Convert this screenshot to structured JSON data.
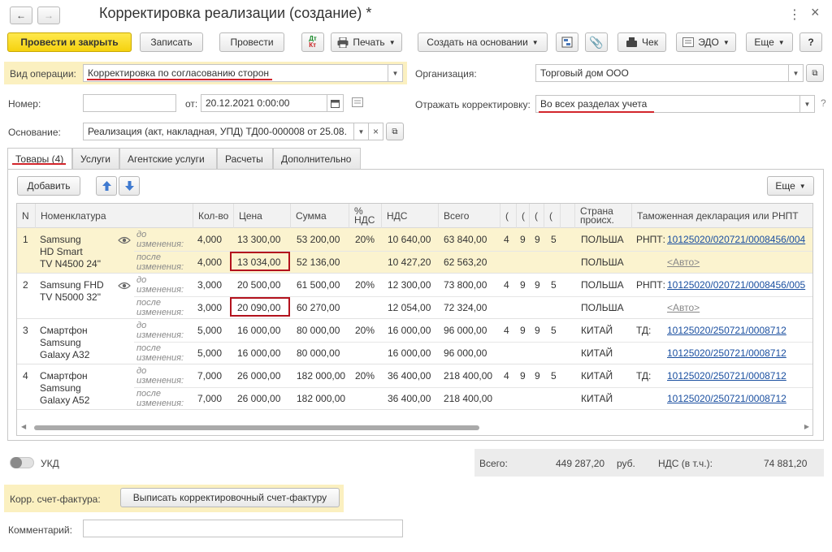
{
  "window": {
    "title": "Корректировка реализации (создание) *",
    "back_glyph": "←",
    "forward_glyph": "→",
    "star_glyph": "☆",
    "more_glyph": "⋮",
    "close_glyph": "×"
  },
  "toolbar": {
    "post_close": "Провести и закрыть",
    "save": "Записать",
    "post": "Провести",
    "dtkt_top": "Дт",
    "dtkt_bottom": "Кт",
    "print": "Печать",
    "create_based": "Создать на основании",
    "check": "Чек",
    "edo": "ЭДО",
    "more": "Еще",
    "help": "?"
  },
  "form": {
    "operation_label": "Вид операции:",
    "operation_value": "Корректировка по согласованию сторон",
    "number_label": "Номер:",
    "number_value": "",
    "date_label": "от:",
    "date_value": "20.12.2021  0:00:00",
    "basis_label": "Основание:",
    "basis_value": "Реализация (акт, накладная, УПД) ТД00-000008 от 25.08.",
    "org_label": "Организация:",
    "org_value": "Торговый дом ООО",
    "reflect_label": "Отражать корректировку:",
    "reflect_value": "Во всех разделах учета"
  },
  "tabs": [
    "Товары (4)",
    "Услуги",
    "Агентские услуги",
    "Расчеты",
    "Дополнительно"
  ],
  "table_toolbar": {
    "add": "Добавить",
    "more": "Еще"
  },
  "columns": {
    "n": "N",
    "item": "Номенклатура",
    "qty": "Кол-во",
    "price": "Цена",
    "sum": "Сумма",
    "vat_rate_1": "%",
    "vat_rate_2": "НДС",
    "vat": "НДС",
    "total": "Всего",
    "c1": "(",
    "c2": "(",
    "c3": "(",
    "c4": "(",
    "country_1": "Страна",
    "country_2": "происх.",
    "customs": "Таможенная декларация или РНПТ"
  },
  "before_note": [
    "до",
    "изменения:"
  ],
  "after_note": [
    "после",
    "изменения:"
  ],
  "rows": [
    {
      "n": "1",
      "item": [
        "Samsung",
        "HD Smart",
        "TV N4500 24\""
      ],
      "eye": true,
      "before": {
        "qty": "4,000",
        "price": "13 300,00",
        "sum": "53 200,00",
        "rate": "20%",
        "vat": "10 640,00",
        "total": "63 840,00",
        "c1": "4",
        "c2": "9",
        "c3": "9",
        "c4": "5",
        "country": "ПОЛЬША",
        "decl_prefix": "РНПТ:",
        "decl": "10125020/020721/0008456/004"
      },
      "after": {
        "qty": "4,000",
        "price": "13 034,00",
        "sum": "52 136,00",
        "vat": "10 427,20",
        "total": "62 563,20",
        "country": "ПОЛЬША",
        "decl": "<Авто>"
      }
    },
    {
      "n": "2",
      "item": [
        "Samsung FHD",
        "TV N5000 32\""
      ],
      "eye": true,
      "before": {
        "qty": "3,000",
        "price": "20 500,00",
        "sum": "61 500,00",
        "rate": "20%",
        "vat": "12 300,00",
        "total": "73 800,00",
        "c1": "4",
        "c2": "9",
        "c3": "9",
        "c4": "5",
        "country": "ПОЛЬША",
        "decl_prefix": "РНПТ:",
        "decl": "10125020/020721/0008456/005"
      },
      "after": {
        "qty": "3,000",
        "price": "20 090,00",
        "sum": "60 270,00",
        "vat": "12 054,00",
        "total": "72 324,00",
        "country": "ПОЛЬША",
        "decl": "<Авто>"
      }
    },
    {
      "n": "3",
      "item": [
        "Смартфон",
        "Samsung",
        "Galaxy A32"
      ],
      "eye": false,
      "before": {
        "qty": "5,000",
        "price": "16 000,00",
        "sum": "80 000,00",
        "rate": "20%",
        "vat": "16 000,00",
        "total": "96 000,00",
        "c1": "4",
        "c2": "9",
        "c3": "9",
        "c4": "5",
        "country": "КИТАЙ",
        "decl_prefix": "ТД:",
        "decl": "10125020/250721/0008712"
      },
      "after": {
        "qty": "5,000",
        "price": "16 000,00",
        "sum": "80 000,00",
        "vat": "16 000,00",
        "total": "96 000,00",
        "country": "КИТАЙ",
        "decl": "10125020/250721/0008712"
      }
    },
    {
      "n": "4",
      "item": [
        "Смартфон",
        "Samsung",
        "Galaxy A52"
      ],
      "eye": false,
      "before": {
        "qty": "7,000",
        "price": "26 000,00",
        "sum": "182 000,00",
        "rate": "20%",
        "vat": "36 400,00",
        "total": "218 400,00",
        "c1": "4",
        "c2": "9",
        "c3": "9",
        "c4": "5",
        "country": "КИТАЙ",
        "decl_prefix": "ТД:",
        "decl": "10125020/250721/0008712"
      },
      "after": {
        "qty": "7,000",
        "price": "26 000,00",
        "sum": "182 000,00",
        "vat": "36 400,00",
        "total": "218 400,00",
        "country": "КИТАЙ",
        "decl": "10125020/250721/0008712"
      }
    }
  ],
  "footer": {
    "ukd_label": "УКД",
    "total_label": "Всего:",
    "total_value": "449 287,20",
    "currency": "руб.",
    "vat_label": "НДС (в т.ч.):",
    "vat_value": "74 881,20",
    "invoice_label": "Корр. счет-фактура:",
    "invoice_button": "Выписать корректировочный счет-фактуру",
    "comment_label": "Комментарий:",
    "comment_value": ""
  },
  "colors": {
    "accent_yellow": "#f5d20f",
    "highlight_row": "#fbf3cf",
    "highlight_box": "#b3121d",
    "link": "#1a4fa0"
  }
}
